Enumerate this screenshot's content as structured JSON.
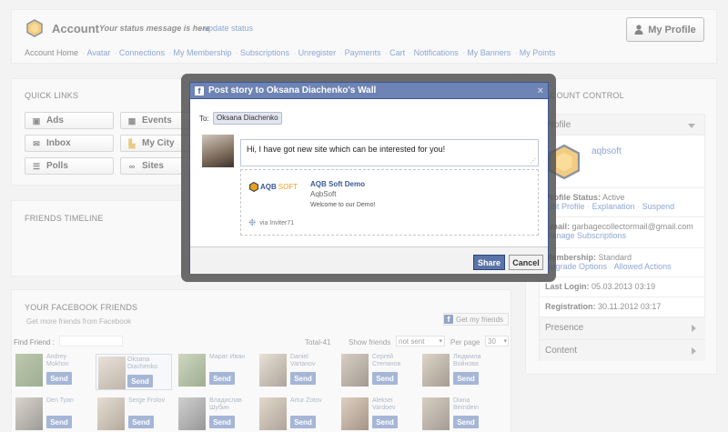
{
  "header": {
    "title": "Account",
    "status_message": "Your status message is here",
    "update_status": "update status",
    "my_profile": "My Profile"
  },
  "nav": {
    "home": "Account Home",
    "links": [
      "Avatar",
      "Connections",
      "My Membership",
      "Subscriptions",
      "Unregister",
      "Payments",
      "Cart",
      "Notifications",
      "My Banners",
      "My Points"
    ]
  },
  "quick_links": {
    "title": "QUICK LINKS",
    "buttons": [
      {
        "label": "Ads",
        "icon": "camera-icon"
      },
      {
        "label": "Events",
        "icon": "calendar-icon"
      },
      {
        "label": "Inbox",
        "icon": "envelope-icon"
      },
      {
        "label": "My City",
        "icon": "city-icon"
      },
      {
        "label": "Polls",
        "icon": "list-icon"
      },
      {
        "label": "Sites",
        "icon": "link-icon"
      }
    ]
  },
  "friends_timeline": {
    "title": "FRIENDS TIMELINE"
  },
  "facebook_friends": {
    "title": "YOUR FACEBOOK FRIENDS",
    "subtitle": "Get more friends from Facebook",
    "get_friends_button": "Get my friends",
    "find_friend_label": "Find Friend :",
    "total": "Total-41",
    "show_friends_label": "Show friends",
    "show_friends_value": "not sent",
    "per_page_label": "Per page",
    "per_page_value": "30",
    "send_label": "Send",
    "friends": [
      {
        "name": "Andrey Mokhov"
      },
      {
        "name": "Oksana Diachenko"
      },
      {
        "name": "Марат Иван"
      },
      {
        "name": "Daniel Vartanov"
      },
      {
        "name": "Сергей Степанов"
      },
      {
        "name": "Людмила Войнова"
      },
      {
        "name": "Den Tyan"
      },
      {
        "name": "Serge Frolov"
      },
      {
        "name": "Владислав Шубин"
      },
      {
        "name": "Artur Zotov"
      },
      {
        "name": "Aleksei Vardoev"
      },
      {
        "name": "Diana Berndein"
      }
    ]
  },
  "account_control": {
    "title": "ACCOUNT CONTROL",
    "profile_head": "Profile",
    "username": "aqbsoft",
    "profile_status_label": "Profile Status:",
    "profile_status_value": "Active",
    "profile_links": [
      "Edit Profile",
      "Explanation",
      "Suspend"
    ],
    "email_label": "Email:",
    "email_value": "garbagecollectormail@gmail.com",
    "manage_subscriptions": "Manage Subscriptions",
    "membership_label": "Membership:",
    "membership_value": "Standard",
    "membership_links": [
      "Upgrade Options",
      "Allowed Actions"
    ],
    "last_login_label": "Last Login:",
    "last_login_value": "05.03.2013 03:19",
    "registration_label": "Registration:",
    "registration_value": "30.11.2012 03:17",
    "presence": "Presence",
    "content": "Content"
  },
  "dialog": {
    "title": "Post story to Oksana Diachenko's Wall",
    "close": "×",
    "to_label": "To:",
    "to_value": "Oksana Diachenko",
    "message": "Hi, I have got new site which can be interested for you!",
    "attachment": {
      "logo_main": "AQB",
      "logo_soft": "SOFT",
      "title": "AQB Soft Demo",
      "subtitle": "AqbSoft",
      "description": "Welcome to our Demo!",
      "via": "via Inviter71"
    },
    "share": "Share",
    "cancel": "Cancel"
  }
}
